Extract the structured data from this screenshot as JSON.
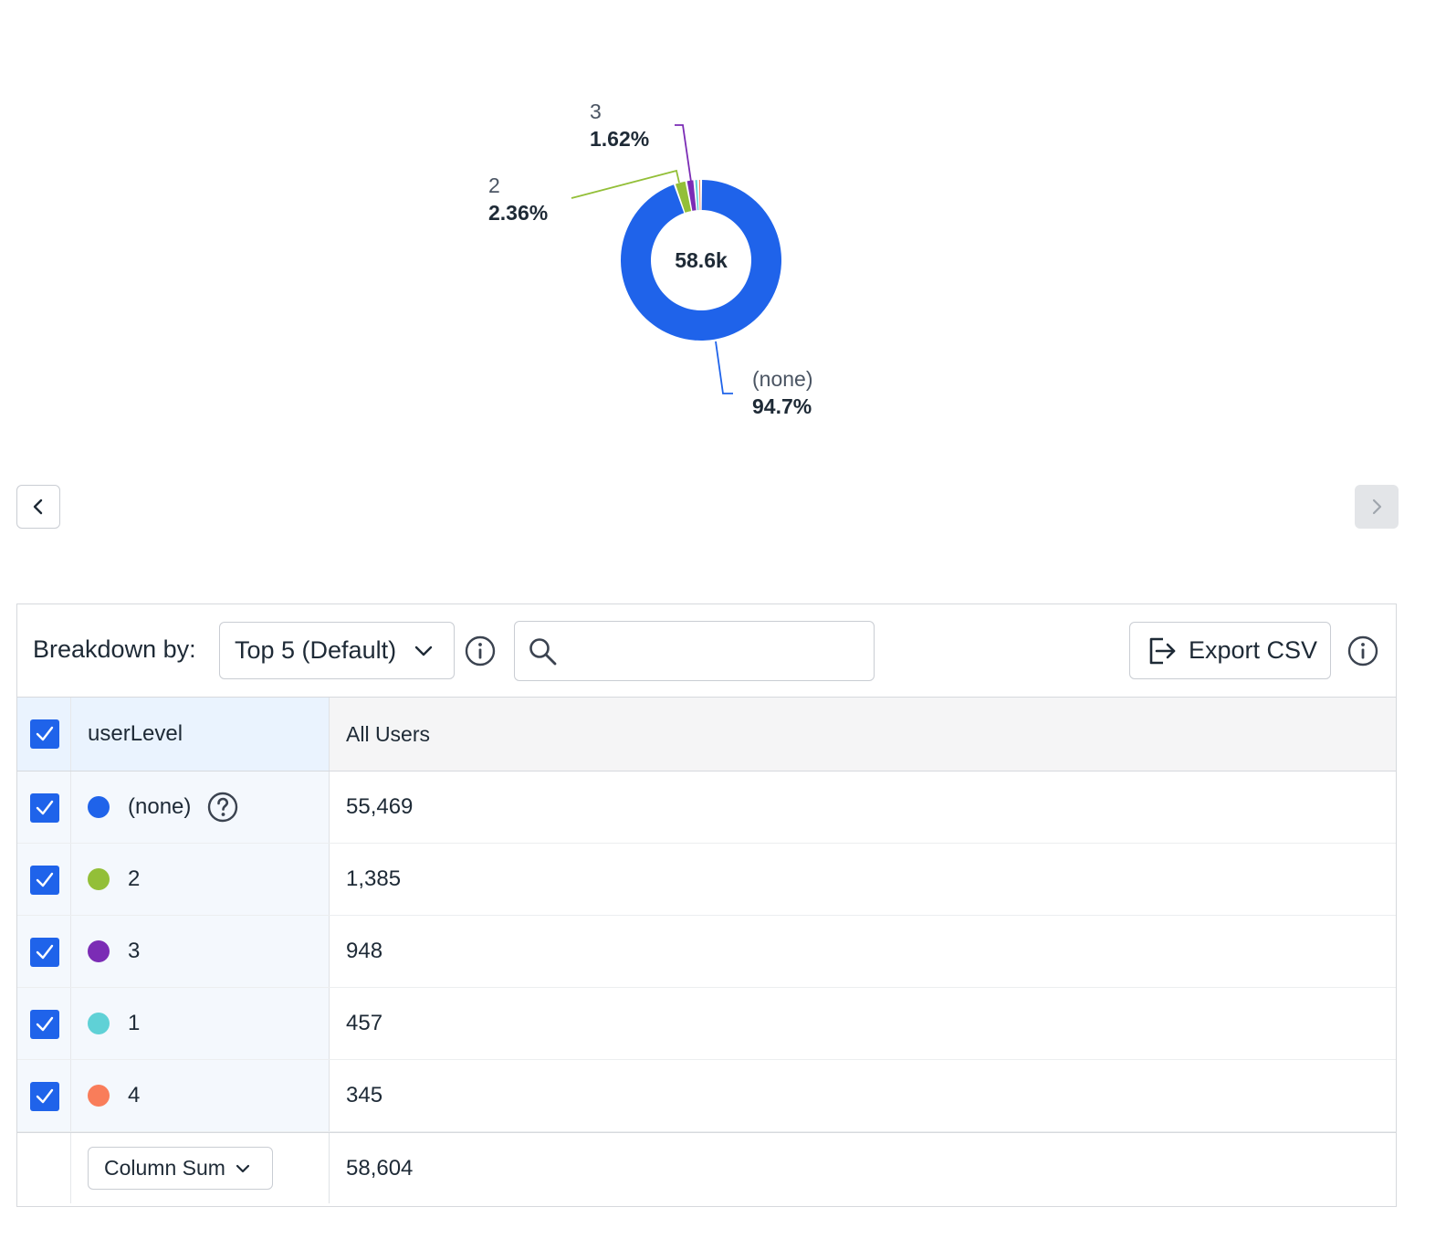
{
  "chart_data": {
    "type": "pie",
    "variant": "donut",
    "center_label": "58.6k",
    "categories": [
      "(none)",
      "2",
      "3",
      "1",
      "4"
    ],
    "values": [
      55469,
      1385,
      948,
      457,
      345
    ],
    "colors": [
      "#1f63ea",
      "#93bf38",
      "#7b2cb5",
      "#5fd1d6",
      "#f97d5a"
    ],
    "slice_labels": [
      {
        "name": "(none)",
        "pct": "94.7%"
      },
      {
        "name": "2",
        "pct": "2.36%"
      },
      {
        "name": "3",
        "pct": "1.62%"
      }
    ],
    "legend": "none"
  },
  "nav": {
    "prev_icon": "chevron-left-icon",
    "next_icon": "chevron-right-icon"
  },
  "toolbar": {
    "breakdown_label": "Breakdown by:",
    "breakdown_value": "Top 5 (Default)",
    "search_placeholder": "",
    "export_label": "Export CSV"
  },
  "table": {
    "headers": [
      "userLevel",
      "All Users"
    ],
    "rows": [
      {
        "label": "(none)",
        "value": "55,469",
        "color": "#1f63ea"
      },
      {
        "label": "2",
        "value": "1,385",
        "color": "#93bf38"
      },
      {
        "label": "3",
        "value": "948",
        "color": "#7b2cb5"
      },
      {
        "label": "1",
        "value": "457",
        "color": "#5fd1d6"
      },
      {
        "label": "4",
        "value": "345",
        "color": "#f97d5a"
      }
    ],
    "footer": {
      "aggregate_label": "Column Sum",
      "value": "58,604"
    }
  }
}
